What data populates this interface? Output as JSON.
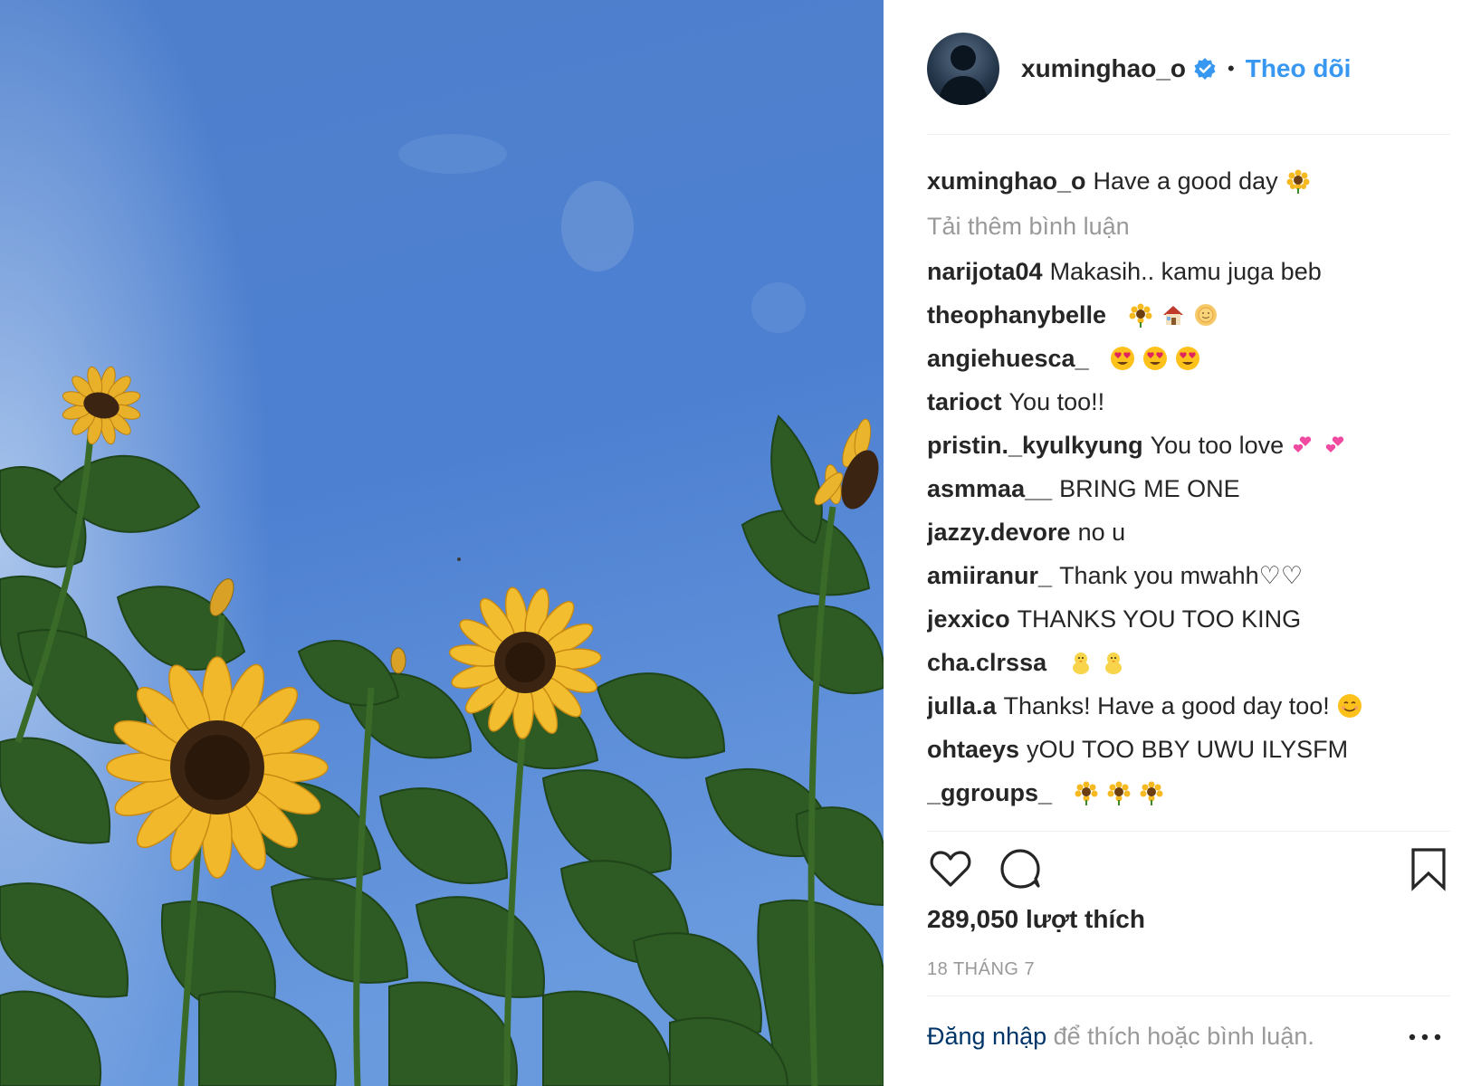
{
  "post": {
    "image_alt_icon": "sunflowers-photo",
    "sky_color": "#4f82cf",
    "leaf_color": "#2f5a23",
    "petal_color": "#f0b82a"
  },
  "header": {
    "username": "xuminghao_o",
    "dot": "•",
    "follow_label": "Theo dõi",
    "accent": "#3897f0"
  },
  "caption": {
    "user": "xuminghao_o",
    "text": "Have a good day"
  },
  "load_more": "Tải thêm bình luận",
  "comments": [
    {
      "user": "narijota04",
      "text": "Makasih.. kamu juga beb"
    },
    {
      "user": "theophanybelle",
      "text": ""
    },
    {
      "user": "angiehuesca_",
      "text": ""
    },
    {
      "user": "tarioct",
      "text": "You too!!"
    },
    {
      "user": "pristin._kyulkyung",
      "text": "You too love"
    },
    {
      "user": "asmmaa__",
      "text": "BRING ME ONE"
    },
    {
      "user": "jazzy.devore",
      "text": "no u"
    },
    {
      "user": "amiiranur_",
      "text": "Thank you mwahh♡♡"
    },
    {
      "user": "jexxico",
      "text": "THANKS YOU TOO KING"
    },
    {
      "user": "cha.clrssa",
      "text": ""
    },
    {
      "user": "julla.a",
      "text": "Thanks! Have a good day too!"
    },
    {
      "user": "ohtaeys",
      "text": "yOU TOO BBY UWU ILYSFM"
    },
    {
      "user": "_ggroups_",
      "text": ""
    }
  ],
  "actions": {
    "like_icon": "heart-icon",
    "comment_icon": "comment-bubble-icon",
    "save_icon": "bookmark-icon"
  },
  "likes": "289,050 lượt thích",
  "date": "18 THÁNG 7",
  "login": {
    "link": "Đăng nhập",
    "rest": "để thích hoặc bình luận."
  },
  "more_icon": "more-options-icon"
}
